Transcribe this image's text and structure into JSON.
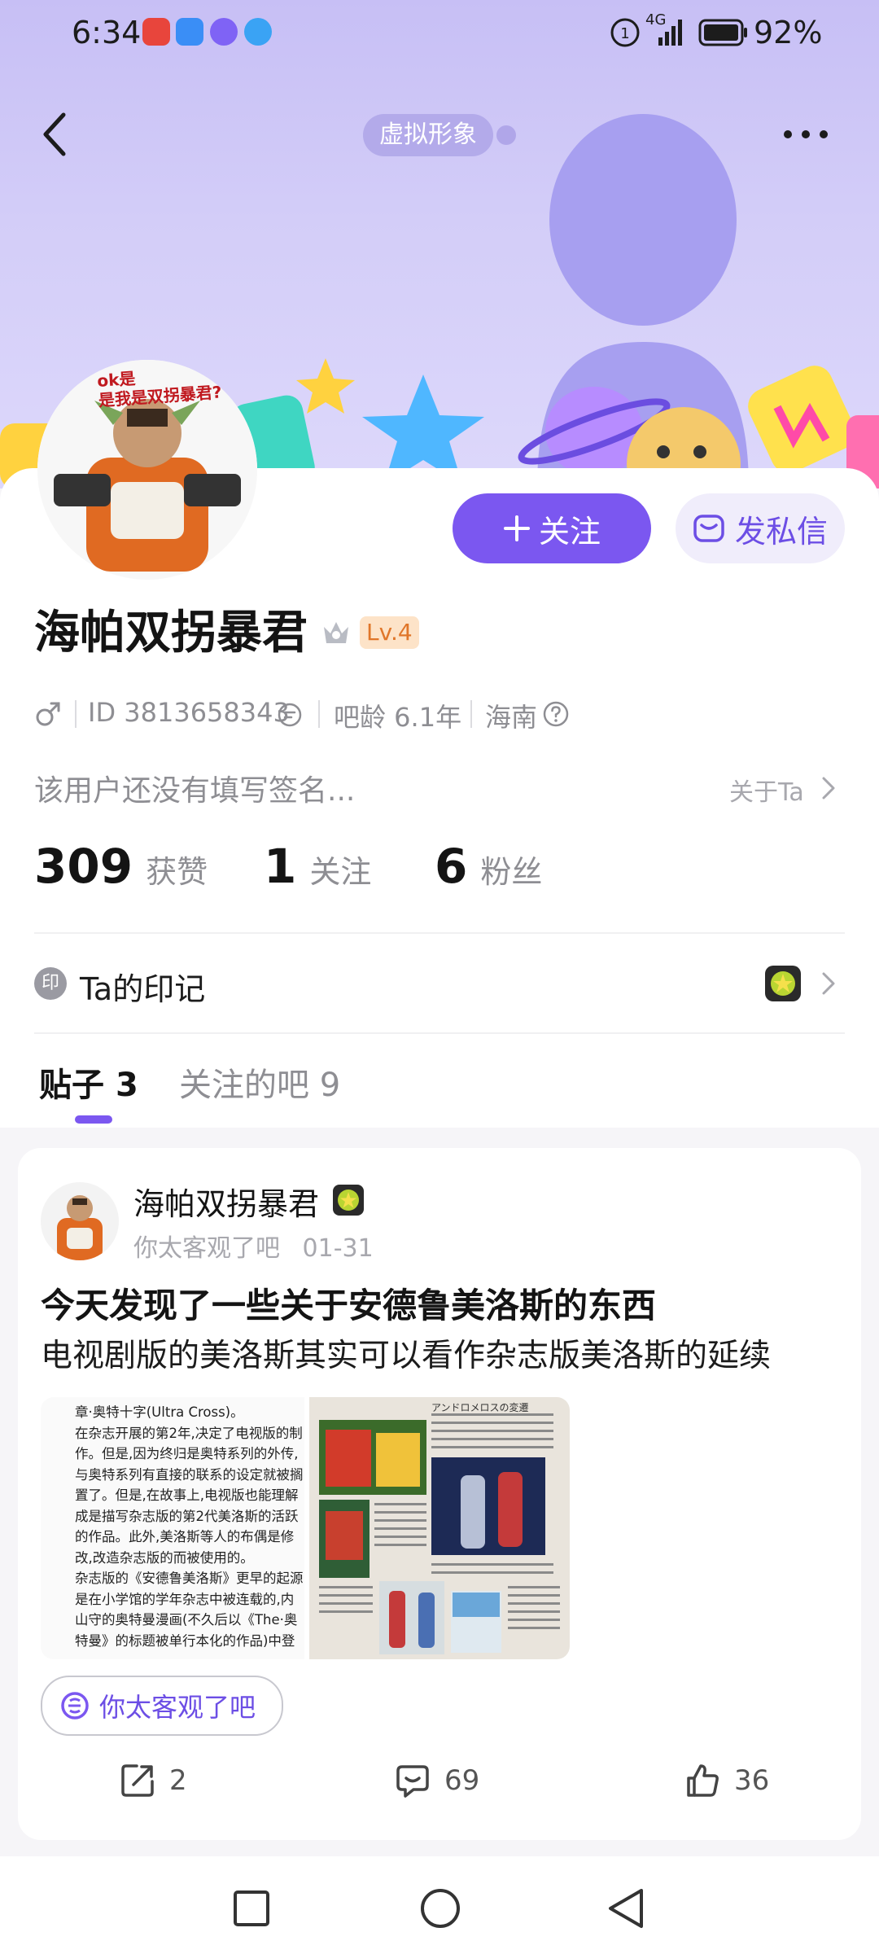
{
  "status_bar": {
    "time": "6:34",
    "network": "4G",
    "battery": "92%"
  },
  "header": {
    "avatar_mode": "虚拟形象",
    "back_icon": "chevron-left-icon",
    "more_icon": "more-horizontal-icon"
  },
  "profile": {
    "avatar_caption": "ok是\n是我是双拐暴君?",
    "username": "海帕双拐暴君",
    "level": "Lv.4",
    "gender_icon": "male-icon",
    "user_id": "ID 3813658343",
    "tieba_age": "吧龄 6.1年",
    "location": "海南",
    "signature": "该用户还没有填写签名...",
    "about": "关于Ta",
    "follow_label": "关注",
    "message_label": "发私信"
  },
  "stats": [
    {
      "value": "309",
      "label": "获赞"
    },
    {
      "value": "1",
      "label": "关注"
    },
    {
      "value": "6",
      "label": "粉丝"
    }
  ],
  "badges": {
    "label": "Ta的印记",
    "icon_letter": "印"
  },
  "tabs": [
    {
      "label": "贴子",
      "count": "3",
      "active": true
    },
    {
      "label": "关注的吧",
      "count": "9",
      "active": false
    }
  ],
  "post": {
    "author": "海帕双拐暴君",
    "forum": "你太客观了吧",
    "date": "01-31",
    "title": "今天发现了一些关于安德鲁美洛斯的东西",
    "body": "电视剧版的美洛斯其实可以看作杂志版美洛斯的延续",
    "image_text": [
      "章·奥特十字(Ultra Cross)。",
      "在杂志开展的第2年,决定了电视版的制",
      "作。但是,因为终归是奥特系列的外传,",
      "与奥特系列有直接的联系的设定就被搁",
      "置了。但是,在故事上,电视版也能理解",
      "成是描写杂志版的第2代美洛斯的活跃",
      "的作品。此外,美洛斯等人的布偶是修",
      "改,改造杂志版的而被使用的。",
      "杂志版的《安德鲁美洛斯》更早的起源",
      "是在小学馆的学年杂志中被连载的,内",
      "山守的奥特曼漫画(不久后以《The·奥",
      "特曼》的标题被单行本化的作品)中登"
    ],
    "magazine_heading": "アンドロメロスの変遷",
    "forum_tag": "你太客观了吧",
    "shares": "2",
    "comments": "69",
    "likes": "36"
  },
  "colors": {
    "accent": "#7b57f0",
    "banner_top": "#c7bff5",
    "level_badge_bg": "#fde3c8",
    "level_badge_text": "#e0762a"
  }
}
